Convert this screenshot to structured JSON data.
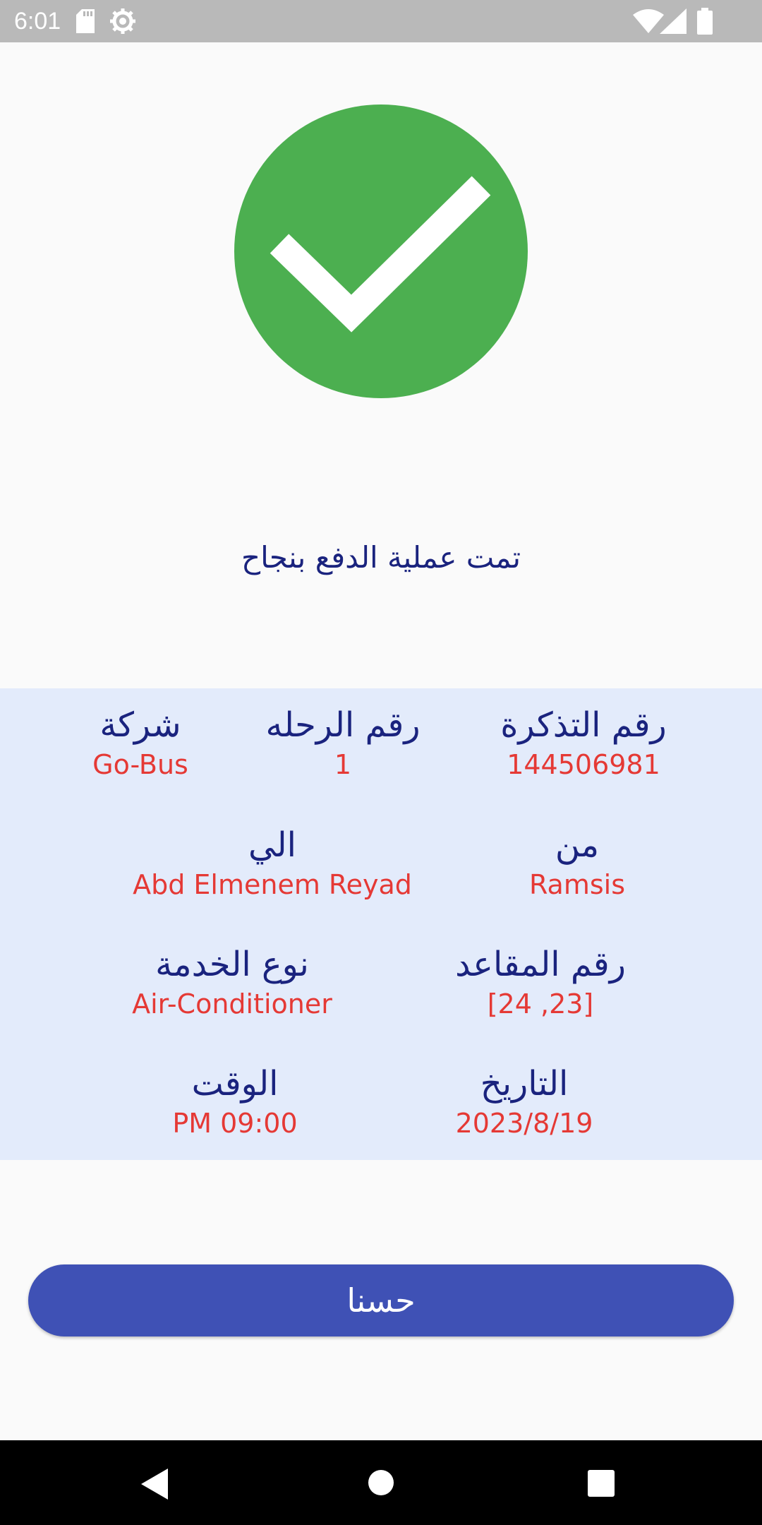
{
  "status_bar": {
    "time": "6:01",
    "icons": [
      "sd-card-icon",
      "gear-icon",
      "wifi-icon",
      "signal-icon",
      "battery-icon"
    ]
  },
  "success": {
    "icon": "check-icon",
    "message": "تمت عملية الدفع بنجاح",
    "color": "#4caf50"
  },
  "ticket": {
    "ticket_number": {
      "label": "رقم التذكرة",
      "value": "144506981"
    },
    "trip_number": {
      "label": "رقم الرحله",
      "value": "1"
    },
    "company": {
      "label": "شركة",
      "value": "Go-Bus"
    },
    "from": {
      "label": "من",
      "value": "Ramsis"
    },
    "to": {
      "label": "الي",
      "value": "Abd Elmenem Reyad"
    },
    "seat_numbers": {
      "label": "رقم المقاعد",
      "value": "[24 ,23]"
    },
    "service_type": {
      "label": "نوع الخدمة",
      "value": "Air-Conditioner"
    },
    "date": {
      "label": "التاريخ",
      "value": "2023/8/19"
    },
    "time": {
      "label": "الوقت",
      "value": "PM 09:00"
    }
  },
  "ok_button": {
    "label": "حسنا",
    "color": "#3f51b5"
  },
  "nav_bar": {
    "icons": [
      "back-icon",
      "home-icon",
      "recents-icon"
    ]
  },
  "colors": {
    "label": "#1a237e",
    "value": "#e53935",
    "panel_bg": "#e3ebfb"
  }
}
